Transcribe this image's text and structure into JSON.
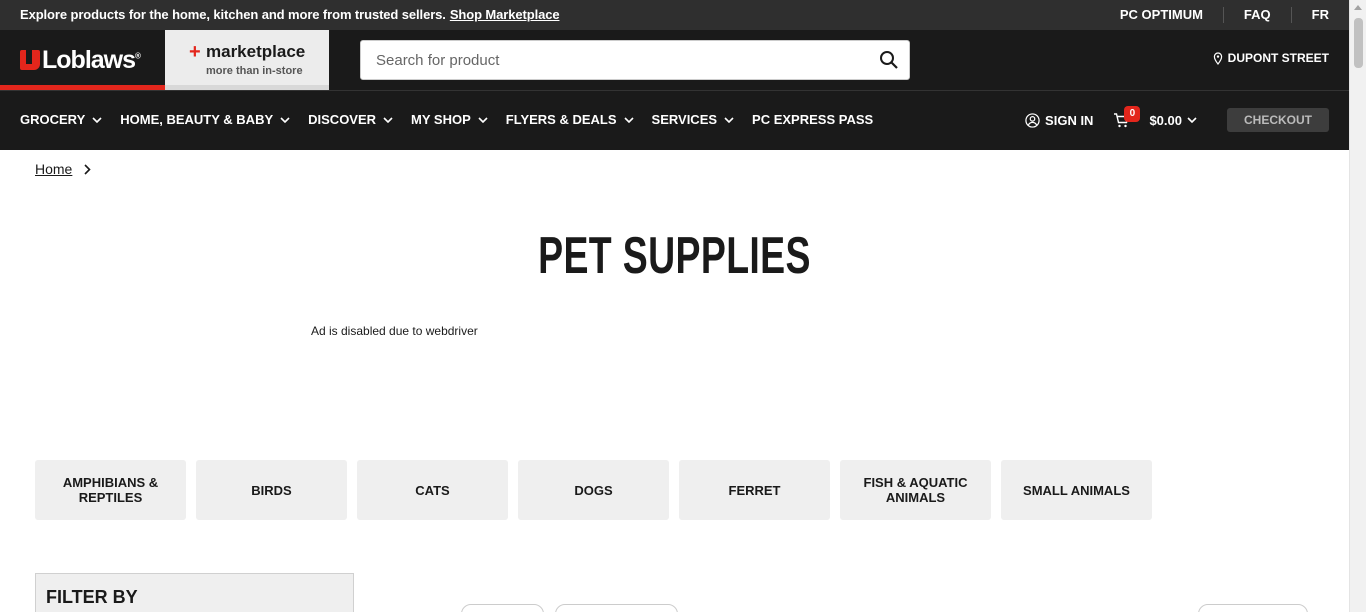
{
  "topbar": {
    "promo_text": "Explore products for the home, kitchen and more from trusted sellers.",
    "promo_link": "Shop Marketplace",
    "links": [
      "PC OPTIMUM",
      "FAQ",
      "FR"
    ]
  },
  "header": {
    "logo_text": "Loblaws",
    "marketplace_title": "marketplace",
    "marketplace_sub": "more than in-store",
    "search_placeholder": "Search for product",
    "store_name": "DUPONT STREET"
  },
  "nav": {
    "items": [
      {
        "label": "GROCERY",
        "dropdown": true
      },
      {
        "label": "HOME, BEAUTY & BABY",
        "dropdown": true
      },
      {
        "label": "DISCOVER",
        "dropdown": true
      },
      {
        "label": "MY SHOP",
        "dropdown": true
      },
      {
        "label": "FLYERS & DEALS",
        "dropdown": true
      },
      {
        "label": "SERVICES",
        "dropdown": true
      },
      {
        "label": "PC EXPRESS PASS",
        "dropdown": false
      }
    ],
    "sign_in": "SIGN IN",
    "cart_count": "0",
    "cart_total": "$0.00",
    "checkout": "CHECKOUT"
  },
  "breadcrumb": {
    "home": "Home"
  },
  "page": {
    "title": "PET SUPPLIES",
    "ad_notice": "Ad is disabled due to webdriver"
  },
  "categories": [
    "AMPHIBIANS & REPTILES",
    "BIRDS",
    "CATS",
    "DOGS",
    "FERRET",
    "FISH & AQUATIC ANIMALS",
    "SMALL ANIMALS"
  ],
  "filter": {
    "heading": "FILTER BY"
  },
  "colors": {
    "brand_red": "#e3261c",
    "header_bg": "#1a1a1a",
    "topbar_bg": "#2f2f2f"
  }
}
